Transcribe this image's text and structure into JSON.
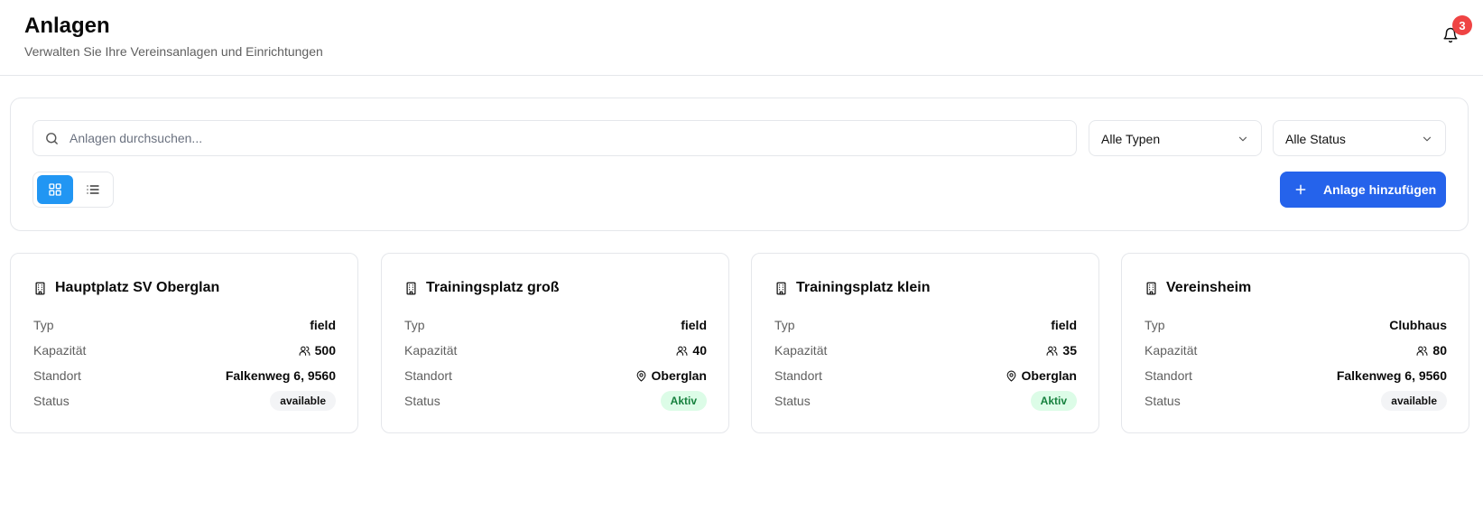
{
  "header": {
    "title": "Anlagen",
    "subtitle": "Verwalten Sie Ihre Vereinsanlagen und Einrichtungen",
    "notifications_count": "3"
  },
  "filters": {
    "search_placeholder": "Anlagen durchsuchen...",
    "type_select": "Alle Typen",
    "status_select": "Alle Status",
    "view_mode": "grid",
    "add_button_label": "Anlage hinzufügen"
  },
  "labels": {
    "type": "Typ",
    "capacity": "Kapazität",
    "location": "Standort",
    "status": "Status"
  },
  "facilities": [
    {
      "name": "Hauptplatz SV Oberglan",
      "type": "field",
      "capacity": "500",
      "location": "Falkenweg 6, 9560",
      "location_icon": false,
      "status": "available",
      "status_color": "gray"
    },
    {
      "name": "Trainingsplatz groß",
      "type": "field",
      "capacity": "40",
      "location": "Oberglan",
      "location_icon": true,
      "status": "Aktiv",
      "status_color": "green"
    },
    {
      "name": "Trainingsplatz klein",
      "type": "field",
      "capacity": "35",
      "location": "Oberglan",
      "location_icon": true,
      "status": "Aktiv",
      "status_color": "green"
    },
    {
      "name": "Vereinsheim",
      "type": "Clubhaus",
      "capacity": "80",
      "location": "Falkenweg 6, 9560",
      "location_icon": false,
      "status": "available",
      "status_color": "gray"
    }
  ],
  "colors": {
    "primary": "#2563eb",
    "view_toggle_active": "#2196f3",
    "badge_red": "#ef4444",
    "status_green_bg": "#dcfce7",
    "status_green_text": "#15803d",
    "status_gray_bg": "#f3f4f6"
  }
}
